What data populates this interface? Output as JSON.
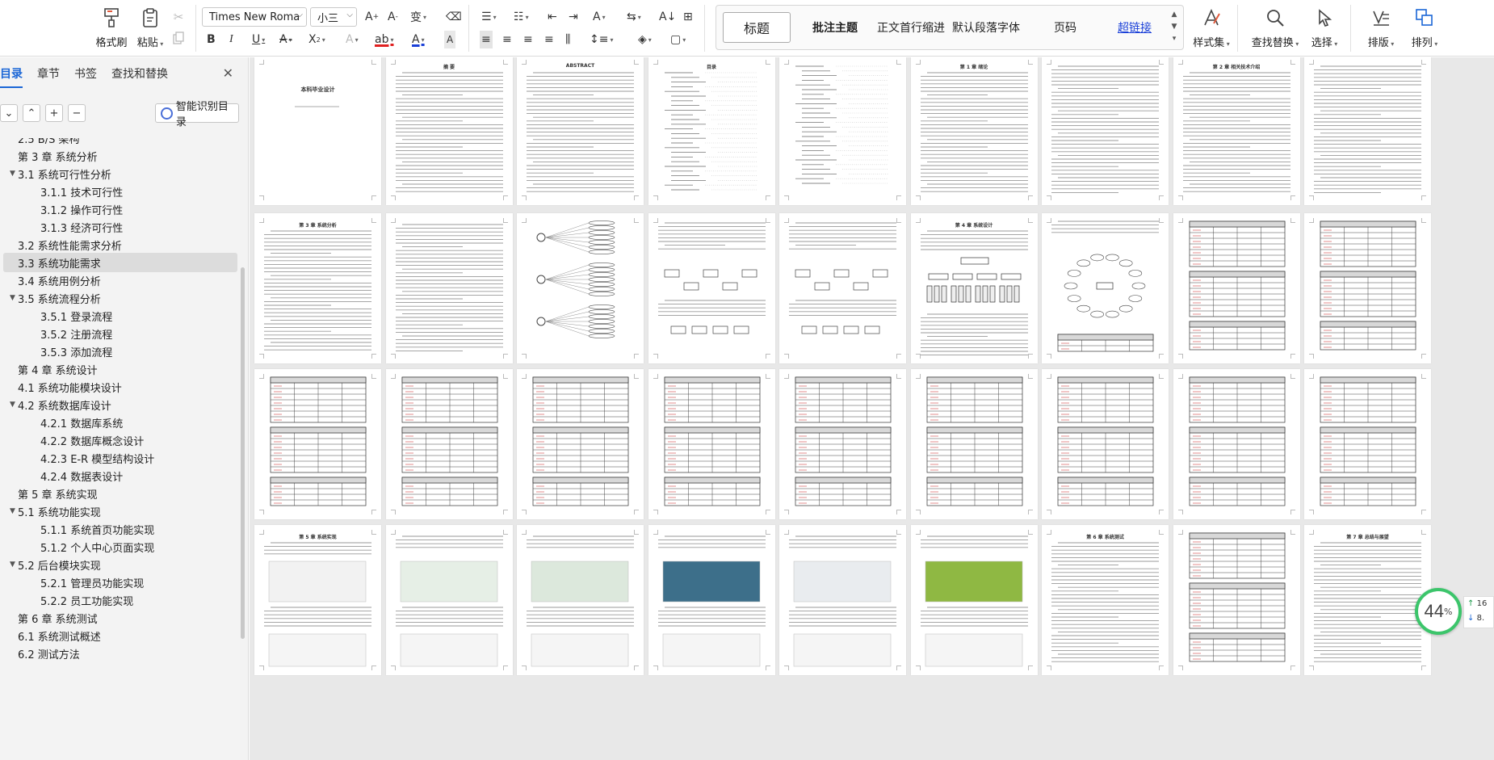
{
  "ribbon": {
    "format_painter": "格式刷",
    "paste": "粘贴",
    "font_name": "Times New Roma",
    "font_size": "小三",
    "styles": [
      {
        "label": "标题",
        "selected": true
      },
      {
        "label": "批注主题",
        "bold": true
      },
      {
        "label": "正文首行缩进"
      },
      {
        "label": "默认段落字体"
      },
      {
        "label": "页码"
      },
      {
        "label": "超链接",
        "link": true
      }
    ],
    "style_set": "样式集",
    "find_replace": "查找替换",
    "select": "选择",
    "layout": "排版",
    "arrange": "排列"
  },
  "sidebar": {
    "tabs": [
      "目录",
      "章节",
      "书签",
      "查找和替换"
    ],
    "active_tab": "目录",
    "smart_toc": "智能识别目录",
    "toc": [
      {
        "label": "2.5 B/S 架构",
        "level": 1
      },
      {
        "label": "第 3 章  系统分析",
        "level": 0
      },
      {
        "label": "3.1  系统可行性分析",
        "level": 1,
        "expand": true
      },
      {
        "label": "3.1.1  技术可行性",
        "level": 2
      },
      {
        "label": "3.1.2  操作可行性",
        "level": 2
      },
      {
        "label": "3.1.3  经济可行性",
        "level": 2
      },
      {
        "label": "3.2 系统性能需求分析",
        "level": 1
      },
      {
        "label": "3.3 系统功能需求",
        "level": 1,
        "selected": true
      },
      {
        "label": "3.4  系统用例分析",
        "level": 1
      },
      {
        "label": "3.5  系统流程分析",
        "level": 1,
        "expand": true
      },
      {
        "label": "3.5.1  登录流程",
        "level": 2
      },
      {
        "label": "3.5.2  注册流程",
        "level": 2
      },
      {
        "label": "3.5.3  添加流程",
        "level": 2
      },
      {
        "label": "第 4 章  系统设计",
        "level": 0
      },
      {
        "label": "4.1 系统功能模块设计",
        "level": 1
      },
      {
        "label": "4.2  系统数据库设计",
        "level": 1,
        "expand": true
      },
      {
        "label": "4.2.1  数据库系统",
        "level": 2
      },
      {
        "label": "4.2.2  数据库概念设计",
        "level": 2
      },
      {
        "label": "4.2.3 E-R 模型结构设计",
        "level": 2
      },
      {
        "label": "4.2.4 数据表设计",
        "level": 2
      },
      {
        "label": "第 5 章  系统实现",
        "level": 0
      },
      {
        "label": "5.1  系统功能实现",
        "level": 1,
        "expand": true
      },
      {
        "label": "5.1.1 系统首页功能实现",
        "level": 2
      },
      {
        "label": "5.1.2 个人中心页面实现",
        "level": 2
      },
      {
        "label": "5.2 后台模块实现",
        "level": 1,
        "expand": true
      },
      {
        "label": "5.2.1 管理员功能实现",
        "level": 2
      },
      {
        "label": "5.2.2 员工功能实现",
        "level": 2
      },
      {
        "label": "第 6 章    系统测试",
        "level": 0
      },
      {
        "label": "6.1  系统测试概述",
        "level": 1
      },
      {
        "label": "6.2  测试方法",
        "level": 1
      }
    ]
  },
  "pages": [
    {
      "type": "cover",
      "title": "本科毕业设计"
    },
    {
      "type": "text",
      "title": "摘  要"
    },
    {
      "type": "text",
      "title": "ABSTRACT"
    },
    {
      "type": "toc",
      "title": "目录"
    },
    {
      "type": "toc"
    },
    {
      "type": "text",
      "title": "第 1 章  绪论"
    },
    {
      "type": "text"
    },
    {
      "type": "text",
      "title": "第 2 章  相关技术介绍"
    },
    {
      "type": "text"
    },
    {
      "type": "text",
      "title": "第 3 章  系统分析"
    },
    {
      "type": "text"
    },
    {
      "type": "usecase"
    },
    {
      "type": "flow"
    },
    {
      "type": "flow"
    },
    {
      "type": "tree",
      "title": "第 4 章  系统设计"
    },
    {
      "type": "er"
    },
    {
      "type": "table"
    },
    {
      "type": "table"
    },
    {
      "type": "table"
    },
    {
      "type": "table"
    },
    {
      "type": "table"
    },
    {
      "type": "table"
    },
    {
      "type": "table"
    },
    {
      "type": "table"
    },
    {
      "type": "table"
    },
    {
      "type": "table"
    },
    {
      "type": "table"
    },
    {
      "type": "shot",
      "title": "第 5 章  系统实现"
    },
    {
      "type": "shot"
    },
    {
      "type": "shot"
    },
    {
      "type": "shot"
    },
    {
      "type": "shot"
    },
    {
      "type": "shot"
    },
    {
      "type": "text",
      "title": "第 6 章  系统测试"
    },
    {
      "type": "table"
    },
    {
      "type": "text",
      "title": "第 7 章  总结与展望"
    }
  ],
  "zoom": {
    "value": "44",
    "unit": "%",
    "up": "16",
    "down": "8."
  },
  "colors": {
    "accent": "#1a66d6",
    "zoom_ring": "#3cc56b"
  }
}
